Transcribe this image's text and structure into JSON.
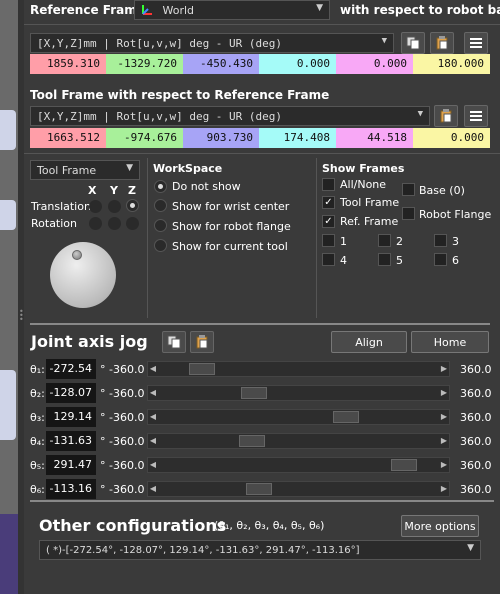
{
  "reference_frame": {
    "label": "Reference Frame",
    "selected": "World",
    "suffix": "with respect to robot base",
    "format": "[X,Y,Z]mm | Rot[u,v,w] deg   - UR (deg)",
    "values": [
      "1859.310",
      "-1329.720",
      "-450.430",
      "0.000",
      "0.000",
      "180.000"
    ]
  },
  "tool_frame": {
    "label": "Tool Frame with respect to Reference Frame",
    "format": "[X,Y,Z]mm | Rot[u,v,w] deg   - UR (deg)",
    "values": [
      "1663.512",
      "-974.676",
      "903.730",
      "174.408",
      "44.518",
      "0.000"
    ]
  },
  "value_colors": [
    "#ff9ea8",
    "#a8f09a",
    "#a7a4f6",
    "#a5fbf8",
    "#f8a8f6",
    "#faf6a4"
  ],
  "jog": {
    "frame_select": "Tool Frame",
    "axes": [
      "X",
      "Y",
      "Z"
    ],
    "translation_label": "Translation",
    "rotation_label": "Rotation"
  },
  "workspace": {
    "title": "WorkSpace",
    "options": [
      "Do not show",
      "Show for wrist center",
      "Show for robot flange",
      "Show for current tool"
    ],
    "selected_index": 0
  },
  "show_frames": {
    "title": "Show Frames",
    "items": [
      {
        "label": "All/None",
        "checked": false
      },
      {
        "label": "Base (0)",
        "checked": false
      },
      {
        "label": "Tool Frame",
        "checked": true
      },
      {
        "label": "Robot Flange",
        "checked": false
      },
      {
        "label": "Ref. Frame",
        "checked": true
      },
      {
        "label": "1",
        "checked": false
      },
      {
        "label": "2",
        "checked": false
      },
      {
        "label": "3",
        "checked": false
      },
      {
        "label": "4",
        "checked": false
      },
      {
        "label": "5",
        "checked": false
      },
      {
        "label": "6",
        "checked": false
      }
    ]
  },
  "joint_jog": {
    "title": "Joint axis jog",
    "align_label": "Align",
    "home_label": "Home",
    "degree_symbol": "°",
    "joints": [
      {
        "name": "θ₁:",
        "value": "-272.54",
        "min": "-360.0",
        "max": "360.0",
        "fraction": 0.121
      },
      {
        "name": "θ₂:",
        "value": "-128.07",
        "min": "-360.0",
        "max": "360.0",
        "fraction": 0.322
      },
      {
        "name": "θ₃:",
        "value": "129.14",
        "min": "-360.0",
        "max": "360.0",
        "fraction": 0.679
      },
      {
        "name": "θ₄:",
        "value": "-131.63",
        "min": "-360.0",
        "max": "360.0",
        "fraction": 0.317
      },
      {
        "name": "θ₅:",
        "value": "291.47",
        "min": "-360.0",
        "max": "360.0",
        "fraction": 0.905
      },
      {
        "name": "θ₆:",
        "value": "-113.16",
        "min": "-360.0",
        "max": "360.0",
        "fraction": 0.343
      }
    ]
  },
  "other_configs": {
    "title": "Other configurations",
    "subtitle": "(θ₁, θ₂, θ₃, θ₄, θ₅, θ₆)",
    "more_options_label": "More options",
    "selected": "( *)-[-272.54°, -128.07°,  129.14°, -131.63°,  291.47°, -113.16°]"
  }
}
